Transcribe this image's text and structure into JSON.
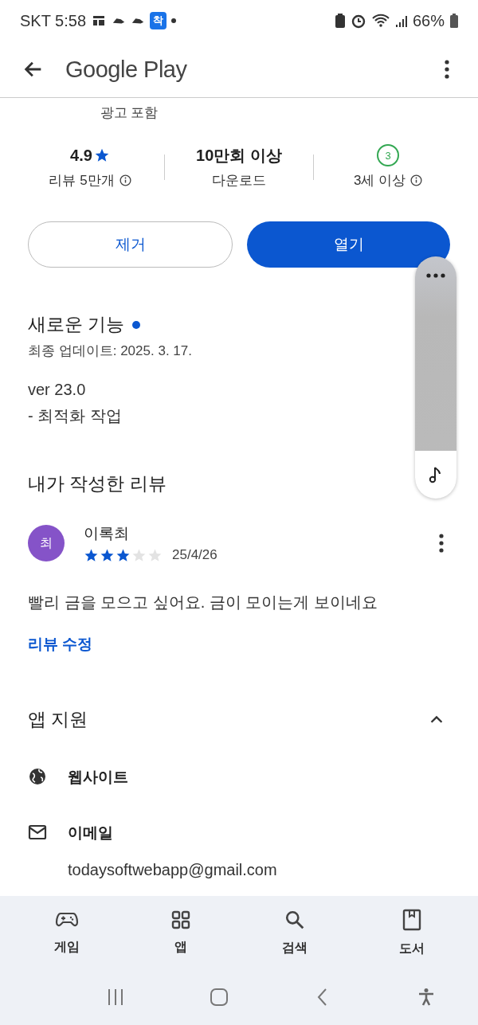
{
  "status_bar": {
    "carrier": "SKT",
    "time": "5:58",
    "notification_badge": "착",
    "battery": "66%"
  },
  "app_bar": {
    "title": "Google Play"
  },
  "ads_note": "광고 포함",
  "stats": [
    {
      "kind": "rating",
      "value": "4.9",
      "label": "리뷰 5만개",
      "info": true
    },
    {
      "kind": "plain",
      "value": "10만회 이상",
      "label": "다운로드",
      "info": false
    },
    {
      "kind": "age",
      "value": "3",
      "label": "3세 이상",
      "info": true
    }
  ],
  "buttons": [
    {
      "kind": "outline",
      "label": "제거"
    },
    {
      "kind": "filled",
      "label": "열기"
    }
  ],
  "whats_new": {
    "title": "새로운 기능",
    "unread": true,
    "updated": "최종 업데이트: 2025. 3. 17.",
    "notes": [
      "ver 23.0",
      "- 최적화 작업"
    ]
  },
  "my_review": {
    "title": "내가 작성한 리뷰",
    "avatar": "최",
    "author": "이록최",
    "stars": 3,
    "date": "25/4/26",
    "text": "빨리 금을 모으고 싶어요. 금이 모이는게 보이네요",
    "edit_link": "리뷰 수정"
  },
  "app_support": {
    "title": "앱 지원",
    "expanded": true,
    "items": [
      {
        "kind": "web",
        "label": "웹사이트"
      },
      {
        "kind": "email",
        "label": "이메일",
        "detail": "todaysoftwebapp@gmail.com"
      }
    ]
  },
  "bottom_nav": [
    {
      "kind": "games",
      "label": "게임",
      "selected": false
    },
    {
      "kind": "apps",
      "label": "앱",
      "selected": false
    },
    {
      "kind": "search",
      "label": "검색",
      "selected": false
    },
    {
      "kind": "books",
      "label": "도서",
      "selected": false
    }
  ]
}
